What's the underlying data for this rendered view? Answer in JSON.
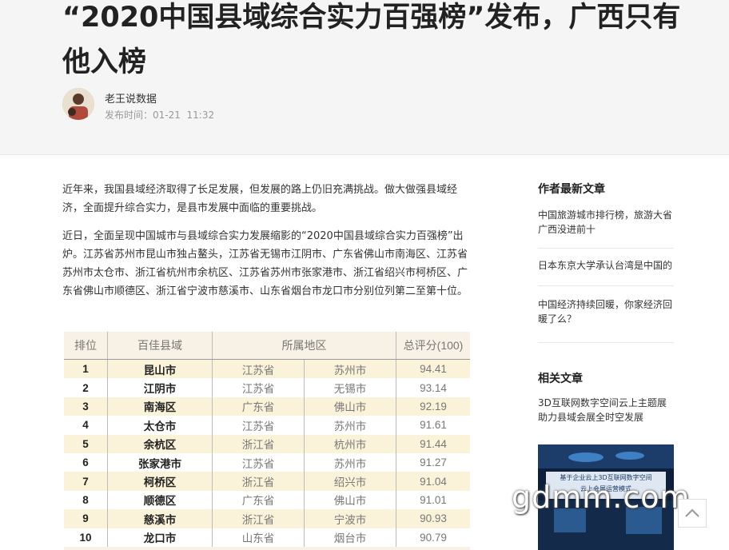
{
  "article": {
    "title": "“2020中国县域综合实力百强榜”发布，广西只有他入榜",
    "author": "老王说数据",
    "publish_label": "发布时间：",
    "publish_date": "01-21",
    "publish_time": "11:32",
    "paragraphs": [
      "近年来，我国县域经济取得了长足发展，但发展的路上仍旧充满挑战。做大做强县域经济，全面提升综合实力，是县市发展中面临的重要挑战。",
      "近日，全面呈现中国城市与县域综合实力发展缩影的“2020中国县域综合实力百强榜”出炉。江苏省苏州市昆山市独占鳌头，江苏省无锡市江阴市、广东省佛山市南海区、江苏省苏州市太仓市、浙江省杭州市余杭区、江苏省苏州市张家港市、浙江省绍兴市柯桥区、广东省佛山市顺德区、浙江省宁波市慈溪市、山东省烟台市龙口市分别位列第二至第十位。"
    ]
  },
  "ranking_table": {
    "headers": [
      "排位",
      "百佳县域",
      "所属地区",
      "总评分(100)"
    ],
    "rows": [
      {
        "rank": "1",
        "name": "昆山市",
        "province": "江苏省",
        "city": "苏州市",
        "score": "94.41"
      },
      {
        "rank": "2",
        "name": "江阴市",
        "province": "江苏省",
        "city": "无锡市",
        "score": "93.14"
      },
      {
        "rank": "3",
        "name": "南海区",
        "province": "广东省",
        "city": "佛山市",
        "score": "92.19"
      },
      {
        "rank": "4",
        "name": "太仓市",
        "province": "江苏省",
        "city": "苏州市",
        "score": "91.61"
      },
      {
        "rank": "5",
        "name": "余杭区",
        "province": "浙江省",
        "city": "杭州市",
        "score": "91.44"
      },
      {
        "rank": "6",
        "name": "张家港市",
        "province": "江苏省",
        "city": "苏州市",
        "score": "91.27"
      },
      {
        "rank": "7",
        "name": "柯桥区",
        "province": "浙江省",
        "city": "绍兴市",
        "score": "91.04"
      },
      {
        "rank": "8",
        "name": "顺德区",
        "province": "广东省",
        "city": "佛山市",
        "score": "91.01"
      },
      {
        "rank": "9",
        "name": "慈溪市",
        "province": "浙江省",
        "city": "宁波市",
        "score": "90.93"
      },
      {
        "rank": "10",
        "name": "龙口市",
        "province": "山东省",
        "city": "烟台市",
        "score": "90.79"
      }
    ]
  },
  "sidebar": {
    "latest_heading": "作者最新文章",
    "latest_articles": [
      "中国旅游城市排行榜，旅游大省广西没进前十",
      "日本东京大学承认台湾是中国的",
      "中国经济持续回暖，你家经济回暖了么？"
    ],
    "related_heading": "相关文章",
    "related_articles": [
      "3D互联网数字空间云上主题展助力县域会展全时空发展"
    ],
    "thumb_caption_1": "基于企业云上3D互联网数字空间",
    "thumb_caption_2": "云上会展运营模式"
  },
  "watermark": "gdmm.com",
  "colors": {
    "header_bg": "#f5f5f5",
    "table_odd": "#fbf3d9",
    "thumb_bg": "#0d1f3a"
  },
  "icons": {
    "back_to_top": "chevron-up-icon"
  }
}
